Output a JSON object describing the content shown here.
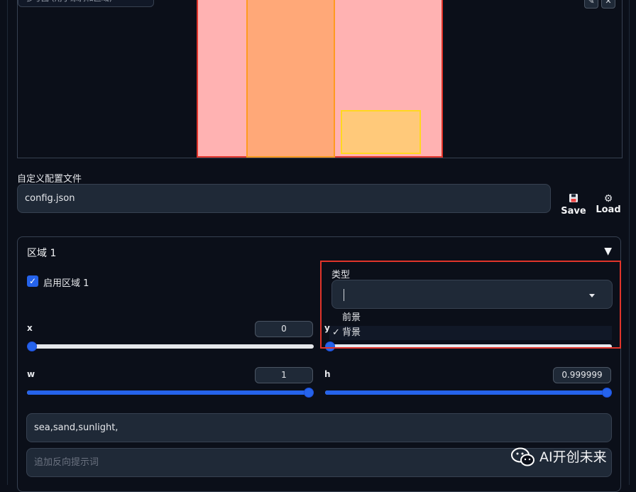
{
  "preview": {
    "label": "参考图 (用于涂鸦和区域)",
    "edit_icon": "pencil-icon",
    "close_icon": "close-icon",
    "colors": {
      "background_region": "#ffb2b2",
      "region_1": "#ffa878",
      "region_2": "#ffc97a"
    }
  },
  "config": {
    "title": "自定义配置文件",
    "value": "config.json",
    "save_label": "Save",
    "save_icon": "floppy-disk-icon",
    "load_label": "Load",
    "load_icon": "gear-icon"
  },
  "region": {
    "title": "区域 1",
    "collapse_icon": "triangle-down-icon",
    "enable_label": "启用区域 1",
    "enable_checked": true,
    "type_label": "类型",
    "type_value": "",
    "type_options": [
      "前景",
      "背景"
    ],
    "type_selected": "背景",
    "check_mark": "✓",
    "x": {
      "label": "x",
      "value": "0",
      "fraction": 0.0
    },
    "y": {
      "label": "y",
      "fraction": 0.0
    },
    "w": {
      "label": "w",
      "value": "1",
      "fraction": 1.0
    },
    "h": {
      "label": "h",
      "value": "0.999999",
      "fraction": 1.0
    },
    "prompt": "sea,sand,sunlight,",
    "negative_placeholder": "追加反向提示词"
  },
  "watermark": {
    "text": "AI开创未来",
    "icon": "wechat-icon"
  },
  "colors": {
    "accent": "#2563eb",
    "highlight": "#e0342a"
  }
}
